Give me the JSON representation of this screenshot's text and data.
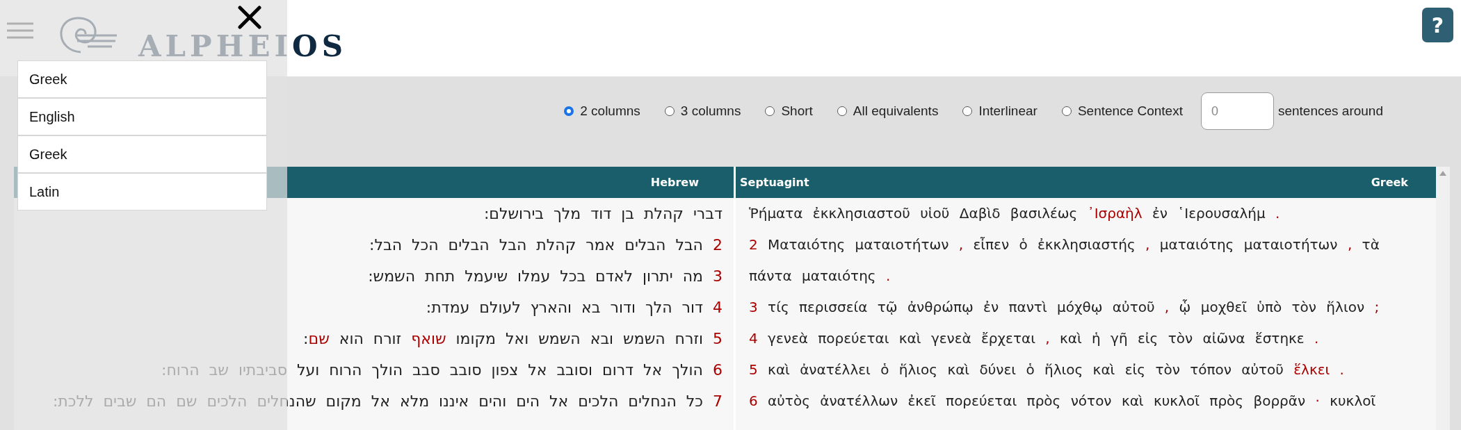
{
  "header": {
    "logo_text": "ALPHEIOS",
    "help_button": "?"
  },
  "language_menu": {
    "items": [
      {
        "label": "Greek"
      },
      {
        "label": "English"
      },
      {
        "label": "Greek"
      },
      {
        "label": "Latin"
      }
    ]
  },
  "view_options": [
    {
      "label": "2 columns",
      "selected": true
    },
    {
      "label": "3 columns",
      "selected": false
    },
    {
      "label": "Short",
      "selected": false
    },
    {
      "label": "All equivalents",
      "selected": false
    },
    {
      "label": "Interlinear",
      "selected": false
    },
    {
      "label": "Sentence Context",
      "selected": false
    }
  ],
  "sentences_field": {
    "placeholder": "0",
    "label": "sentences around"
  },
  "table": {
    "left_header": {
      "language": "Hebrew"
    },
    "right_header": {
      "title": "Septuagint",
      "language": "Greek"
    },
    "hebrew_verses": [
      {
        "segments": [
          {
            "text": "דברי קהלת בן דוד מלך בירושלם:",
            "highlight": false
          }
        ]
      },
      {
        "number": "2",
        "segments": [
          {
            "text": "הבל הבלים אמר קהלת הבל הבלים הכל הבל:",
            "highlight": false
          }
        ]
      },
      {
        "number": "3",
        "segments": [
          {
            "text": "מה יתרון לאדם בכל עמלו שיעמל תחת השמש:",
            "highlight": false
          }
        ]
      },
      {
        "number": "4",
        "segments": [
          {
            "text": "דור הלך ודור בא והארץ לעולם עמדת:",
            "highlight": false
          }
        ]
      },
      {
        "number": "5",
        "segments": [
          {
            "text": "וזרח השמש ובא השמש ואל מקומו ",
            "highlight": false
          },
          {
            "text": "שואף",
            "highlight": true
          },
          {
            "text": " זורח הוא ",
            "highlight": false
          },
          {
            "text": "שם",
            "highlight": true
          },
          {
            "text": ":",
            "highlight": false
          }
        ]
      },
      {
        "number": "6",
        "segments": [
          {
            "text": "הולך אל דרום וסובב אל צפון סובב סבב הולך הרוח ועל סביבתיו שב הרוח:",
            "highlight": false
          }
        ]
      },
      {
        "number": "7",
        "segments": [
          {
            "text": "כל הנחלים הלכים אל הים והים איננו מלא אל מקום שהנחלים הלכים שם הם שבים ללכת:",
            "highlight": false
          }
        ]
      }
    ],
    "greek_verses": [
      {
        "segments": [
          {
            "text": "Ῥήματα ἐκκλησιαστοῦ υἱοῦ Δαβὶδ βασιλέως ",
            "highlight": false
          },
          {
            "text": "᾿Ισραὴλ",
            "highlight": true
          },
          {
            "text": " ἐν ῾Ιερουσαλήμ ",
            "highlight": false
          },
          {
            "text": ".",
            "highlight": true
          }
        ]
      },
      {
        "number": "2",
        "segments": [
          {
            "text": "Ματαιότης ματαιοτήτων ",
            "highlight": false
          },
          {
            "text": ",",
            "highlight": true
          },
          {
            "text": " εἶπεν ὁ ἐκκλησιαστής ",
            "highlight": false
          },
          {
            "text": ",",
            "highlight": true
          },
          {
            "text": " ματαιότης ματαιοτήτων ",
            "highlight": false
          },
          {
            "text": ",",
            "highlight": true
          },
          {
            "text": " τὰ πάντα ματαιότης ",
            "highlight": false
          },
          {
            "text": ".",
            "highlight": true
          }
        ]
      },
      {
        "number": "3",
        "segments": [
          {
            "text": "τίς περισσεία τῷ ἀνθρώπῳ ἐν παντὶ μόχθῳ αὐτοῦ ",
            "highlight": false
          },
          {
            "text": ",",
            "highlight": true
          },
          {
            "text": " ᾧ μοχθεῖ ὑπὸ τὸν ἥλιον ",
            "highlight": false
          },
          {
            "text": ";",
            "highlight": true
          }
        ]
      },
      {
        "number": "4",
        "segments": [
          {
            "text": "γενεὰ πορεύεται καὶ γενεὰ ἔρχεται ",
            "highlight": false
          },
          {
            "text": ",",
            "highlight": true
          },
          {
            "text": " καὶ ἡ γῆ εἰς τὸν αἰῶνα ἕστηκε ",
            "highlight": false
          },
          {
            "text": ".",
            "highlight": true
          }
        ]
      },
      {
        "number": "5",
        "segments": [
          {
            "text": "καὶ ἀνατέλλει ὁ ἥλιος καὶ δύνει ὁ ἥλιος καὶ εἰς τὸν τόπον αὐτοῦ ",
            "highlight": false
          },
          {
            "text": "ἕλκει .",
            "highlight": true
          }
        ]
      },
      {
        "number": "6",
        "segments": [
          {
            "text": "αὐτὸς ἀνατέλλων ἐκεῖ πορεύεται πρὸς νότον καὶ κυκλοῖ πρὸς βορρᾶν ",
            "highlight": false
          },
          {
            "text": "·",
            "highlight": true
          },
          {
            "text": " κυκλοῖ",
            "highlight": false
          }
        ]
      }
    ]
  }
}
